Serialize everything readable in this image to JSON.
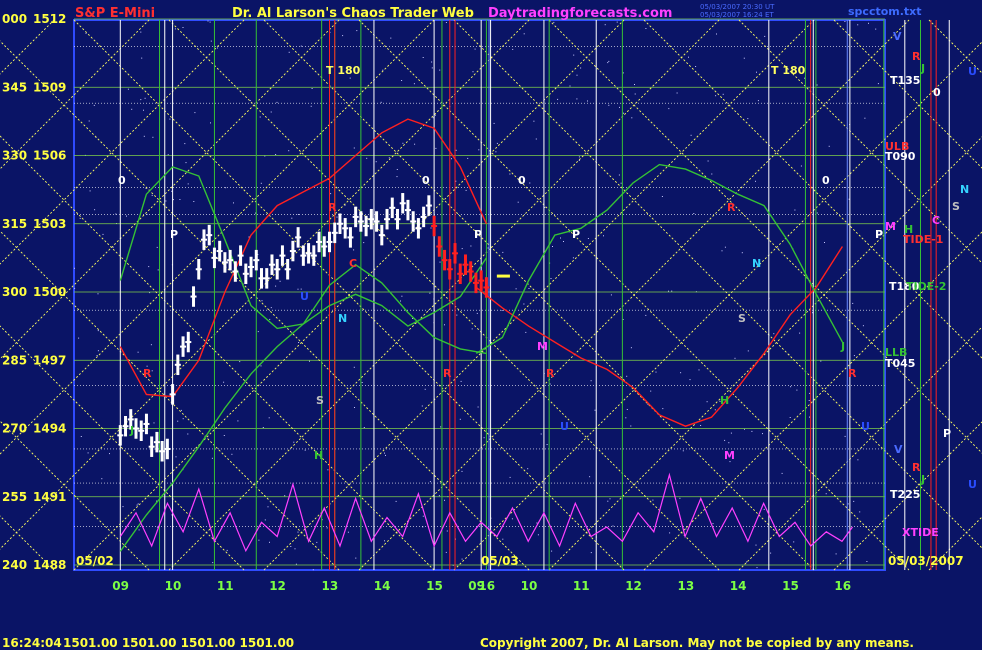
{
  "header": {
    "title_left": "S&P E-Mini",
    "title_center": "Dr. Al Larson's Chaos Trader Web",
    "title_site": "Daytradingforecasts.com",
    "timestamp_line1": "05/03/2007 20:30 UT",
    "timestamp_line2": "05/03/2007 16:24 ET",
    "file_name": "spcctom.txt"
  },
  "footer": {
    "time": "16:24:04",
    "quotes": "1501.00 1501.00 1501.00 1501.00",
    "copyright": "Copyright 2007, Dr. Al Larson. May not be copied by any means."
  },
  "colors": {
    "background": "#0a1466",
    "plot_border": "#2f4bff",
    "grid_h": "#7fd14a",
    "price_bars": "#ffffff",
    "red_line": "#ff2020",
    "green_line": "#35c235",
    "magenta_line": "#ff40ff",
    "yellow_dotted": "#ffff60",
    "axis_hours": "#7cff44"
  },
  "chart_data": {
    "type": "line",
    "title": "S&P E-Mini",
    "ylabels": [
      {
        "left": "000",
        "price": "1512",
        "value": 1512
      },
      {
        "left": "345",
        "price": "1509",
        "value": 1509
      },
      {
        "left": "330",
        "price": "1506",
        "value": 1506
      },
      {
        "left": "315",
        "price": "1503",
        "value": 1503
      },
      {
        "left": "300",
        "price": "1500",
        "value": 1500
      },
      {
        "left": "285",
        "price": "1497",
        "value": 1497
      },
      {
        "left": "270",
        "price": "1494",
        "value": 1494
      },
      {
        "left": "255",
        "price": "1491",
        "value": 1491
      },
      {
        "left": "240",
        "price": "1488",
        "value": 1488
      }
    ],
    "ylim": [
      1488,
      1512.6
    ],
    "day_labels": [
      "05/02",
      "05/03",
      "05/03/2007"
    ],
    "hours_day1": [
      "09",
      "10",
      "11",
      "12",
      "13",
      "14",
      "15",
      "16"
    ],
    "hours_day2": [
      "09",
      "10",
      "11",
      "12",
      "13",
      "14",
      "15",
      "16"
    ],
    "price_series_day1": [
      [
        9.0,
        1493.7
      ],
      [
        9.1,
        1494.1
      ],
      [
        9.2,
        1494.4
      ],
      [
        9.3,
        1494.0
      ],
      [
        9.4,
        1493.9
      ],
      [
        9.5,
        1494.2
      ],
      [
        9.6,
        1493.2
      ],
      [
        9.7,
        1493.4
      ],
      [
        9.8,
        1493.0
      ],
      [
        9.9,
        1493.1
      ],
      [
        10.0,
        1495.5
      ],
      [
        10.1,
        1496.8
      ],
      [
        10.2,
        1497.6
      ],
      [
        10.3,
        1497.8
      ],
      [
        10.4,
        1499.8
      ],
      [
        10.5,
        1501.0
      ],
      [
        10.6,
        1502.3
      ],
      [
        10.7,
        1502.5
      ],
      [
        10.8,
        1501.5
      ],
      [
        10.9,
        1501.8
      ],
      [
        11.0,
        1501.3
      ],
      [
        11.1,
        1501.4
      ],
      [
        11.2,
        1500.9
      ],
      [
        11.3,
        1501.6
      ],
      [
        11.4,
        1500.8
      ],
      [
        11.5,
        1501.1
      ],
      [
        11.6,
        1501.4
      ],
      [
        11.7,
        1500.6
      ],
      [
        11.8,
        1500.6
      ],
      [
        11.9,
        1501.2
      ],
      [
        12.0,
        1501.0
      ],
      [
        12.1,
        1501.6
      ],
      [
        12.2,
        1501.0
      ],
      [
        12.3,
        1501.8
      ],
      [
        12.4,
        1502.4
      ],
      [
        12.5,
        1501.6
      ],
      [
        12.6,
        1501.7
      ],
      [
        12.7,
        1501.6
      ],
      [
        12.8,
        1502.2
      ],
      [
        12.9,
        1502.0
      ],
      [
        13.0,
        1502.2
      ],
      [
        13.1,
        1502.6
      ],
      [
        13.2,
        1503.0
      ],
      [
        13.3,
        1502.8
      ],
      [
        13.4,
        1502.4
      ],
      [
        13.5,
        1503.3
      ],
      [
        13.6,
        1503.1
      ],
      [
        13.7,
        1502.9
      ],
      [
        13.8,
        1503.2
      ],
      [
        13.9,
        1503.1
      ],
      [
        14.0,
        1502.5
      ],
      [
        14.1,
        1503.2
      ],
      [
        14.2,
        1503.7
      ],
      [
        14.3,
        1503.2
      ],
      [
        14.4,
        1503.9
      ],
      [
        14.5,
        1503.6
      ],
      [
        14.6,
        1503.1
      ],
      [
        14.7,
        1502.8
      ],
      [
        14.8,
        1503.3
      ],
      [
        14.9,
        1503.8
      ]
    ],
    "price_series_late": [
      [
        15.0,
        1502.9
      ],
      [
        15.1,
        1502.0
      ],
      [
        15.2,
        1501.4
      ],
      [
        15.3,
        1501.0
      ],
      [
        15.4,
        1501.7
      ],
      [
        15.5,
        1500.8
      ],
      [
        15.6,
        1501.2
      ],
      [
        15.7,
        1500.9
      ],
      [
        15.8,
        1500.4
      ],
      [
        15.9,
        1500.5
      ],
      [
        16.0,
        1500.2
      ]
    ],
    "red_line_day1": [
      [
        9.0,
        1497.6
      ],
      [
        9.5,
        1495.5
      ],
      [
        10.0,
        1495.4
      ],
      [
        10.5,
        1497.0
      ],
      [
        11.0,
        1500.0
      ],
      [
        11.5,
        1502.5
      ],
      [
        12.0,
        1503.8
      ],
      [
        12.5,
        1504.4
      ],
      [
        13.0,
        1505.0
      ],
      [
        13.5,
        1506.0
      ],
      [
        14.0,
        1507.0
      ],
      [
        14.5,
        1507.6
      ],
      [
        15.0,
        1507.2
      ],
      [
        15.5,
        1505.5
      ],
      [
        16.0,
        1503.0
      ]
    ],
    "red_line_day2": [
      [
        9.0,
        1500.2
      ],
      [
        9.5,
        1499.3
      ],
      [
        10.0,
        1498.5
      ],
      [
        10.5,
        1497.8
      ],
      [
        11.0,
        1497.1
      ],
      [
        11.5,
        1496.6
      ],
      [
        12.0,
        1495.8
      ],
      [
        12.5,
        1494.6
      ],
      [
        13.0,
        1494.1
      ],
      [
        13.5,
        1494.5
      ],
      [
        14.0,
        1495.8
      ],
      [
        14.5,
        1497.3
      ],
      [
        15.0,
        1499.0
      ],
      [
        15.5,
        1500.2
      ],
      [
        16.0,
        1502.0
      ]
    ],
    "green_line_day1": [
      [
        9.0,
        1500.5
      ],
      [
        9.5,
        1504.3
      ],
      [
        10.0,
        1505.5
      ],
      [
        10.5,
        1505.1
      ],
      [
        11.0,
        1502.3
      ],
      [
        11.5,
        1499.4
      ],
      [
        12.0,
        1498.4
      ],
      [
        12.5,
        1498.6
      ],
      [
        13.0,
        1500.3
      ],
      [
        13.5,
        1501.2
      ],
      [
        14.0,
        1500.4
      ],
      [
        14.5,
        1499.1
      ],
      [
        15.0,
        1498.0
      ],
      [
        15.5,
        1497.5
      ],
      [
        16.0,
        1497.3
      ]
    ],
    "green_line_day2": [
      [
        9.0,
        1497.3
      ],
      [
        9.5,
        1498.0
      ],
      [
        10.0,
        1500.5
      ],
      [
        10.5,
        1502.5
      ],
      [
        11.0,
        1502.8
      ],
      [
        11.5,
        1503.6
      ],
      [
        12.0,
        1504.8
      ],
      [
        12.5,
        1505.6
      ],
      [
        13.0,
        1505.4
      ],
      [
        13.5,
        1504.9
      ],
      [
        14.0,
        1504.3
      ],
      [
        14.5,
        1503.8
      ],
      [
        15.0,
        1502.1
      ],
      [
        15.5,
        1499.9
      ],
      [
        16.0,
        1497.8
      ]
    ],
    "second_green_day1": [
      [
        9.0,
        1488.6
      ],
      [
        9.5,
        1490.2
      ],
      [
        10.0,
        1491.6
      ],
      [
        10.5,
        1493.2
      ],
      [
        11.0,
        1494.9
      ],
      [
        11.5,
        1496.4
      ],
      [
        12.0,
        1497.6
      ],
      [
        12.5,
        1498.6
      ],
      [
        13.0,
        1499.4
      ],
      [
        13.5,
        1499.9
      ],
      [
        14.0,
        1499.4
      ],
      [
        14.5,
        1498.5
      ],
      [
        15.0,
        1499.1
      ],
      [
        15.5,
        1499.8
      ],
      [
        16.0,
        1501.5
      ]
    ],
    "xtide": [
      [
        9.0,
        0.3
      ],
      [
        9.3,
        0.55
      ],
      [
        9.6,
        0.2
      ],
      [
        9.9,
        0.65
      ],
      [
        10.2,
        0.35
      ],
      [
        10.5,
        0.8
      ],
      [
        10.8,
        0.25
      ],
      [
        11.1,
        0.55
      ],
      [
        11.4,
        0.15
      ],
      [
        11.7,
        0.45
      ],
      [
        12.0,
        0.3
      ],
      [
        12.3,
        0.85
      ],
      [
        12.6,
        0.25
      ],
      [
        12.9,
        0.6
      ],
      [
        13.2,
        0.2
      ],
      [
        13.5,
        0.7
      ],
      [
        13.8,
        0.25
      ],
      [
        14.1,
        0.5
      ],
      [
        14.4,
        0.3
      ],
      [
        14.7,
        0.75
      ],
      [
        15.0,
        0.2
      ],
      [
        15.3,
        0.55
      ],
      [
        15.6,
        0.25
      ],
      [
        15.9,
        0.45
      ],
      [
        16.2,
        0.3
      ],
      [
        16.5,
        0.6
      ],
      [
        16.8,
        0.25
      ],
      [
        17.1,
        0.55
      ],
      [
        17.4,
        0.2
      ],
      [
        17.7,
        0.65
      ],
      [
        18.0,
        0.3
      ],
      [
        18.3,
        0.4
      ],
      [
        18.6,
        0.25
      ],
      [
        18.9,
        0.55
      ],
      [
        19.2,
        0.35
      ],
      [
        19.5,
        0.95
      ],
      [
        19.8,
        0.3
      ],
      [
        20.1,
        0.7
      ],
      [
        20.4,
        0.3
      ],
      [
        20.7,
        0.6
      ],
      [
        21.0,
        0.25
      ],
      [
        21.3,
        0.65
      ],
      [
        21.6,
        0.3
      ],
      [
        21.9,
        0.45
      ],
      [
        22.2,
        0.2
      ],
      [
        22.5,
        0.35
      ],
      [
        22.8,
        0.25
      ],
      [
        23.0,
        0.4
      ]
    ],
    "right_labels": [
      {
        "text": "V",
        "color": "#4a6bff"
      },
      {
        "text": "R",
        "color": "#ff3030"
      },
      {
        "text": "J",
        "color": "#35c235"
      },
      {
        "text": "U",
        "color": "#2a4dff"
      },
      {
        "text": "T135",
        "color": "#ffffff"
      },
      {
        "text": "0",
        "color": "#ffffff"
      },
      {
        "text": "ULB",
        "color": "#ff3030"
      },
      {
        "text": "T090",
        "color": "#ffffff"
      },
      {
        "text": "N",
        "color": "#35d3ff"
      },
      {
        "text": "S",
        "color": "#bfbfbf"
      },
      {
        "text": "C",
        "color": "#ff40ff"
      },
      {
        "text": "M",
        "color": "#ff40ff"
      },
      {
        "text": "H",
        "color": "#35c235"
      },
      {
        "text": "TIDE-1",
        "color": "#ff3030"
      },
      {
        "text": "P",
        "color": "#ffffff"
      },
      {
        "text": "T180",
        "color": "#ffffff"
      },
      {
        "text": "TIDE-2",
        "color": "#35c235"
      },
      {
        "text": "LLB",
        "color": "#35c235"
      },
      {
        "text": "T045",
        "color": "#ffffff"
      },
      {
        "text": "P",
        "color": "#ffffff"
      },
      {
        "text": "V",
        "color": "#4a6bff"
      },
      {
        "text": "R",
        "color": "#ff3030"
      },
      {
        "text": "J",
        "color": "#35c235"
      },
      {
        "text": "U",
        "color": "#2a4dff"
      },
      {
        "text": "T225",
        "color": "#ffffff"
      },
      {
        "text": "XTIDE",
        "color": "#ff40ff"
      }
    ],
    "plot_labels": [
      {
        "text": "T 180",
        "color": "#ffff60"
      },
      {
        "text": "T 180",
        "color": "#ffff60"
      },
      {
        "text": "0",
        "color": "#ffffff"
      },
      {
        "text": "0",
        "color": "#ffffff"
      },
      {
        "text": "0",
        "color": "#ffffff"
      },
      {
        "text": "0",
        "color": "#ffffff"
      },
      {
        "text": "P",
        "color": "#ffffff"
      },
      {
        "text": "P",
        "color": "#ffffff"
      },
      {
        "text": "P",
        "color": "#ffffff"
      },
      {
        "text": "P",
        "color": "#ffffff"
      },
      {
        "text": "R",
        "color": "#ff3030"
      },
      {
        "text": "R",
        "color": "#ff3030"
      },
      {
        "text": "R",
        "color": "#ff3030"
      },
      {
        "text": "R",
        "color": "#ff3030"
      },
      {
        "text": "R",
        "color": "#ff3030"
      },
      {
        "text": "R",
        "color": "#ff3030"
      },
      {
        "text": "C",
        "color": "#ff3030"
      },
      {
        "text": "N",
        "color": "#35d3ff"
      },
      {
        "text": "N",
        "color": "#35d3ff"
      },
      {
        "text": "S",
        "color": "#bfbfbf"
      },
      {
        "text": "S",
        "color": "#bfbfbf"
      },
      {
        "text": "H",
        "color": "#35c235"
      },
      {
        "text": "H",
        "color": "#35c235"
      },
      {
        "text": "M",
        "color": "#ff40ff"
      },
      {
        "text": "M",
        "color": "#ff40ff"
      },
      {
        "text": "J",
        "color": "#35c235"
      },
      {
        "text": "J",
        "color": "#35c235"
      },
      {
        "text": "U",
        "color": "#2a4dff"
      },
      {
        "text": "U",
        "color": "#2a4dff"
      },
      {
        "text": "U",
        "color": "#2a4dff"
      }
    ]
  }
}
